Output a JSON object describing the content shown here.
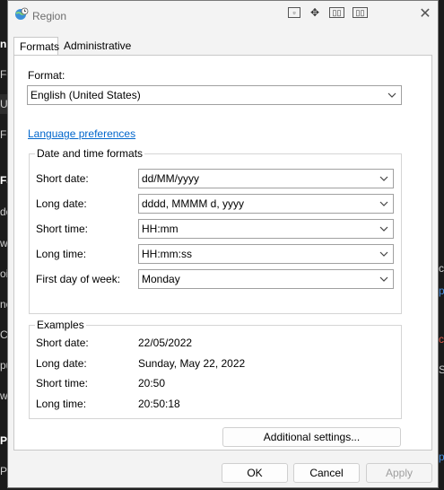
{
  "background": {
    "left_glyphs": [
      "n",
      "Fo",
      "Up",
      "Fi",
      "Fa",
      "do",
      "wa",
      "oi",
      "nc",
      "Ch",
      "pu",
      "wa",
      "Pr",
      "Pe"
    ],
    "right_glyphs": [
      "ci",
      "p",
      "ct",
      "Si",
      "p"
    ]
  },
  "window": {
    "title": "Region",
    "titlebar_icons": [
      "restore-box-icon",
      "move-icon",
      "snap-left-icon",
      "snap-right-icon"
    ],
    "close_glyph": "✕"
  },
  "tabs": [
    {
      "label": "Formats",
      "active": true
    },
    {
      "label": "Administrative",
      "active": false
    }
  ],
  "formats": {
    "format_label": "Format:",
    "format_value": "English (United States)",
    "language_link": "Language preferences",
    "datetime_group_title": "Date and time formats",
    "fields": [
      {
        "label": "Short date:",
        "value": "dd/MM/yyyy"
      },
      {
        "label": "Long date:",
        "value": "dddd, MMMM d, yyyy"
      },
      {
        "label": "Short time:",
        "value": "HH:mm"
      },
      {
        "label": "Long time:",
        "value": "HH:mm:ss"
      },
      {
        "label": "First day of week:",
        "value": "Monday"
      }
    ],
    "examples_title": "Examples",
    "examples": [
      {
        "label": "Short date:",
        "value": "22/05/2022"
      },
      {
        "label": "Long date:",
        "value": "Sunday, May 22, 2022"
      },
      {
        "label": "Short time:",
        "value": "20:50"
      },
      {
        "label": "Long time:",
        "value": "20:50:18"
      }
    ],
    "additional_settings": "Additional settings..."
  },
  "footer": {
    "ok": "OK",
    "cancel": "Cancel",
    "apply": "Apply"
  },
  "colors": {
    "link": "#0066cc",
    "dialog_bg": "#f3f3f3",
    "background_app": "#202020"
  }
}
